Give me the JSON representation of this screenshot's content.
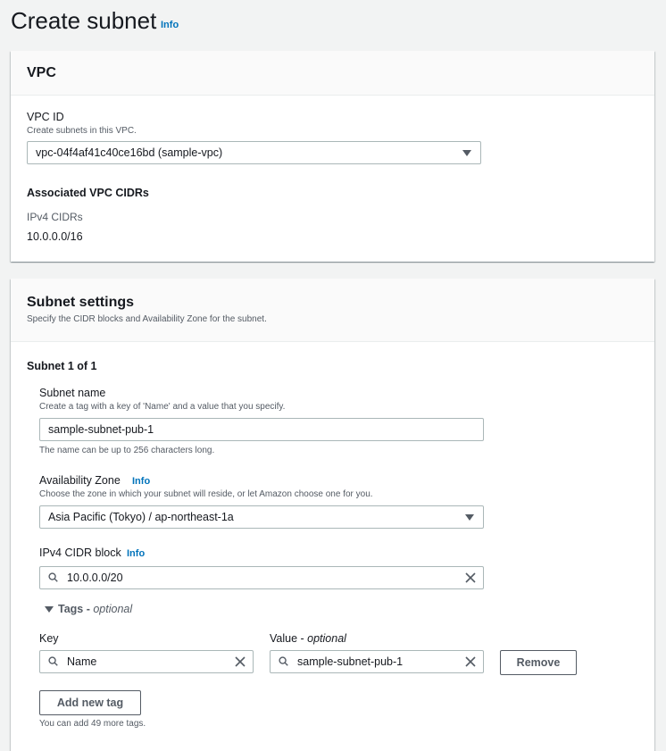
{
  "page": {
    "title": "Create subnet",
    "info": "Info"
  },
  "vpc_panel": {
    "heading": "VPC",
    "vpc_id_label": "VPC ID",
    "vpc_id_desc": "Create subnets in this VPC.",
    "vpc_id_value": "vpc-04f4af41c40ce16bd (sample-vpc)",
    "cidrs_heading": "Associated VPC CIDRs",
    "ipv4_label": "IPv4 CIDRs",
    "ipv4_value": "10.0.0.0/16"
  },
  "subnet_panel": {
    "heading": "Subnet settings",
    "desc": "Specify the CIDR blocks and Availability Zone for the subnet.",
    "counter": "Subnet 1 of 1",
    "name_label": "Subnet name",
    "name_desc": "Create a tag with a key of 'Name' and a value that you specify.",
    "name_value": "sample-subnet-pub-1",
    "name_hint": "The name can be up to 256 characters long.",
    "az_label": "Availability Zone",
    "az_info": "Info",
    "az_desc": "Choose the zone in which your subnet will reside, or let Amazon choose one for you.",
    "az_value": "Asia Pacific (Tokyo) / ap-northeast-1a",
    "cidr_label": "IPv4 CIDR block",
    "cidr_info": "Info",
    "cidr_value": "10.0.0.0/20",
    "tags_label": "Tags - ",
    "tags_optional": "optional",
    "key_label": "Key",
    "value_label": "Value - ",
    "value_optional": "optional",
    "key_value": "Name",
    "tag_value": "sample-subnet-pub-1",
    "remove_button": "Remove",
    "add_tag_button": "Add new tag",
    "tags_hint": "You can add 49 more tags."
  }
}
